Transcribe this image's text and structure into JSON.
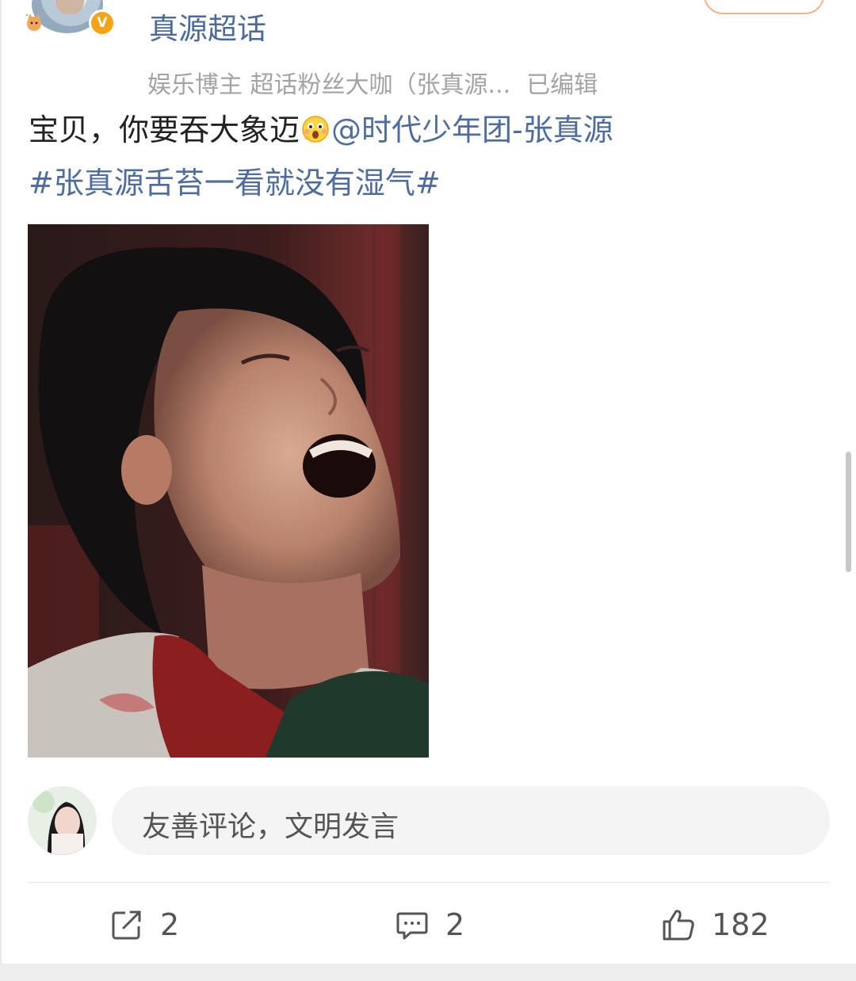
{
  "header": {
    "username": "真源超话",
    "meta_tags": "娱乐博主 超话粉丝大咖（张真源...",
    "edited": "已编辑",
    "verified_badge": "V",
    "avatar_icon": "user-avatar",
    "badge_color": "#f7a31a"
  },
  "post": {
    "text_plain": "宝贝，你要吞大象迈",
    "emoji_icon": "shocked-face-icon",
    "mention": "@时代少年团-张真源",
    "hashtag": "#张真源舌苔一看就没有湿气#",
    "link_color": "#4e6d9e"
  },
  "comment_box": {
    "placeholder": "友善评论，文明发言"
  },
  "actions": {
    "share_count": "2",
    "comment_count": "2",
    "like_count": "182"
  }
}
